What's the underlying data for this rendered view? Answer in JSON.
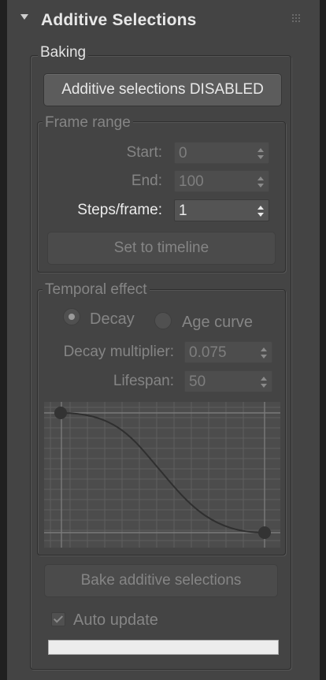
{
  "rollout": {
    "title": "Additive Selections"
  },
  "baking": {
    "group_label": "Baking",
    "toggle_button_label": "Additive selections DISABLED",
    "frame_range": {
      "group_label": "Frame range",
      "start_label": "Start:",
      "start_value": "0",
      "end_label": "End:",
      "end_value": "100",
      "steps_label": "Steps/frame:",
      "steps_value": "1",
      "set_timeline_label": "Set to timeline"
    },
    "temporal_effect": {
      "group_label": "Temporal effect",
      "decay_label": "Decay",
      "age_curve_label": "Age curve",
      "selected_mode": "Decay",
      "decay_multiplier_label": "Decay multiplier:",
      "decay_multiplier_value": "0.075",
      "lifespan_label": "Lifespan:",
      "lifespan_value": "50"
    },
    "bake_button_label": "Bake additive selections",
    "auto_update_label": "Auto update",
    "auto_update_checked": true
  },
  "colors": {
    "panel_bg": "#444444",
    "field_bg": "#545454",
    "disabled_text": "#858585",
    "enabled_text": "#ececec"
  },
  "icons": {
    "collapse": "triangle-down",
    "grip": "dot-grid",
    "spinner": "up-down-arrows",
    "checkbox": "check-mark"
  }
}
